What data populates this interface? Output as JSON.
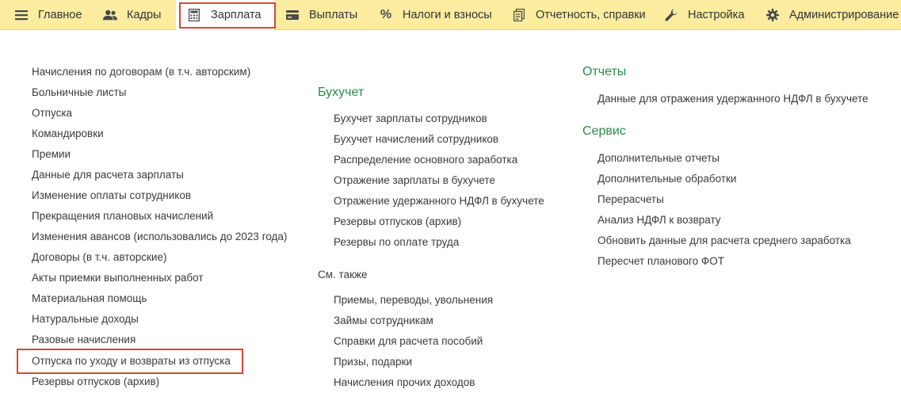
{
  "nav": {
    "items": [
      {
        "label": "Главное",
        "icon": "menu-icon"
      },
      {
        "label": "Кадры",
        "icon": "users-icon"
      },
      {
        "label": "Зарплата",
        "icon": "calculator-icon"
      },
      {
        "label": "Выплаты",
        "icon": "card-icon"
      },
      {
        "label": "Налоги и взносы",
        "icon": "percent-icon"
      },
      {
        "label": "Отчетность, справки",
        "icon": "documents-icon"
      },
      {
        "label": "Настройка",
        "icon": "wrench-icon"
      },
      {
        "label": "Администрирование",
        "icon": "gear-icon"
      }
    ],
    "active": "Зарплата"
  },
  "left_column": {
    "items": [
      "Начисления по договорам (в т.ч. авторским)",
      "Больничные листы",
      "Отпуска",
      "Командировки",
      "Премии",
      "Данные для расчета зарплаты",
      "Изменение оплаты сотрудников",
      "Прекращения плановых начислений",
      "Изменения авансов (использовались до 2023 года)",
      "Договоры (в т.ч. авторские)",
      "Акты приемки выполненных работ",
      "Материальная помощь",
      "Натуральные доходы",
      "Разовые начисления",
      "Отпуска по уходу и возвраты из отпуска",
      "Резервы отпусков (архив)"
    ]
  },
  "middle_column": {
    "section_title": "Бухучет",
    "items": [
      "Бухучет зарплаты сотрудников",
      "Бухучет начислений сотрудников",
      "Распределение основного заработка",
      "Отражение зарплаты в бухучете",
      "Отражение удержанного НДФЛ в бухучете",
      "Резервы отпусков (архив)",
      "Резервы по оплате труда"
    ],
    "see_also_title": "См. также",
    "see_also_items": [
      "Приемы, переводы, увольнения",
      "Займы сотрудникам",
      "Справки для расчета пособий",
      "Призы, подарки",
      "Начисления прочих доходов"
    ]
  },
  "right_column": {
    "reports_title": "Отчеты",
    "reports_items": [
      "Данные для отражения удержанного НДФЛ в бухучете"
    ],
    "service_title": "Сервис",
    "service_items": [
      "Дополнительные отчеты",
      "Дополнительные обработки",
      "Перерасчеты",
      "Анализ НДФЛ к возврату",
      "Обновить данные для расчета среднего заработка",
      "Пересчет планового ФОТ"
    ]
  },
  "colors": {
    "topbar": "#fbeca0",
    "section_title": "#2c8a4a",
    "highlight": "#d9463c"
  }
}
